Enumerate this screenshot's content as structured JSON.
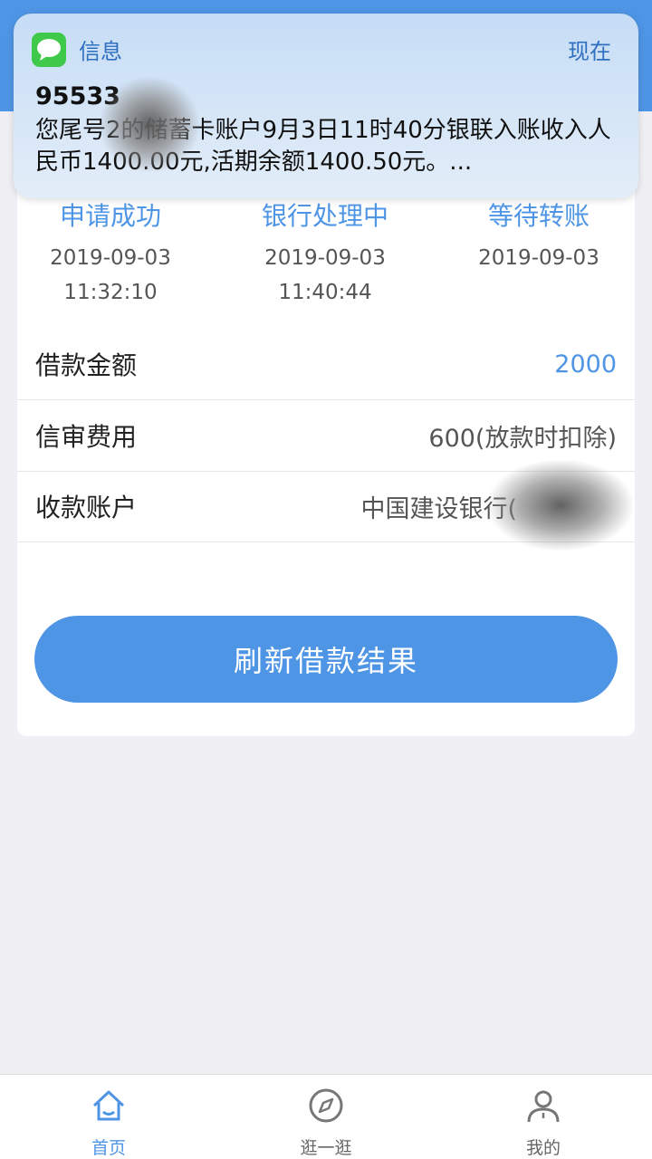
{
  "notification": {
    "app_name": "信息",
    "time": "现在",
    "sender": "95533",
    "body": "您尾号2的储蓄卡账户9月3日11时40分银联入账收入人民币1400.00元,活期余额1400.50元。..."
  },
  "progress": {
    "steps": [
      {
        "label": "申请成功",
        "date": "2019-09-03",
        "time": "11:32:10"
      },
      {
        "label": "银行处理中",
        "date": "2019-09-03",
        "time": "11:40:44"
      },
      {
        "label": "等待转账",
        "date": "2019-09-03",
        "time": ""
      }
    ]
  },
  "details": {
    "loan_amount_label": "借款金额",
    "loan_amount_value": "2000",
    "fee_label": "信审费用",
    "fee_value": "600(放款时扣除)",
    "account_label": "收款账户",
    "account_value": "中国建设银行("
  },
  "refresh_button": "刷新借款结果",
  "tabbar": {
    "tabs": [
      {
        "label": "首页",
        "icon": "home-icon",
        "active": true
      },
      {
        "label": "逛一逛",
        "icon": "compass-icon",
        "active": false
      },
      {
        "label": "我的",
        "icon": "user-icon",
        "active": false
      }
    ]
  },
  "colors": {
    "accent": "#4f95e5",
    "background": "#efeff4",
    "messages_green": "#3fc94a"
  }
}
